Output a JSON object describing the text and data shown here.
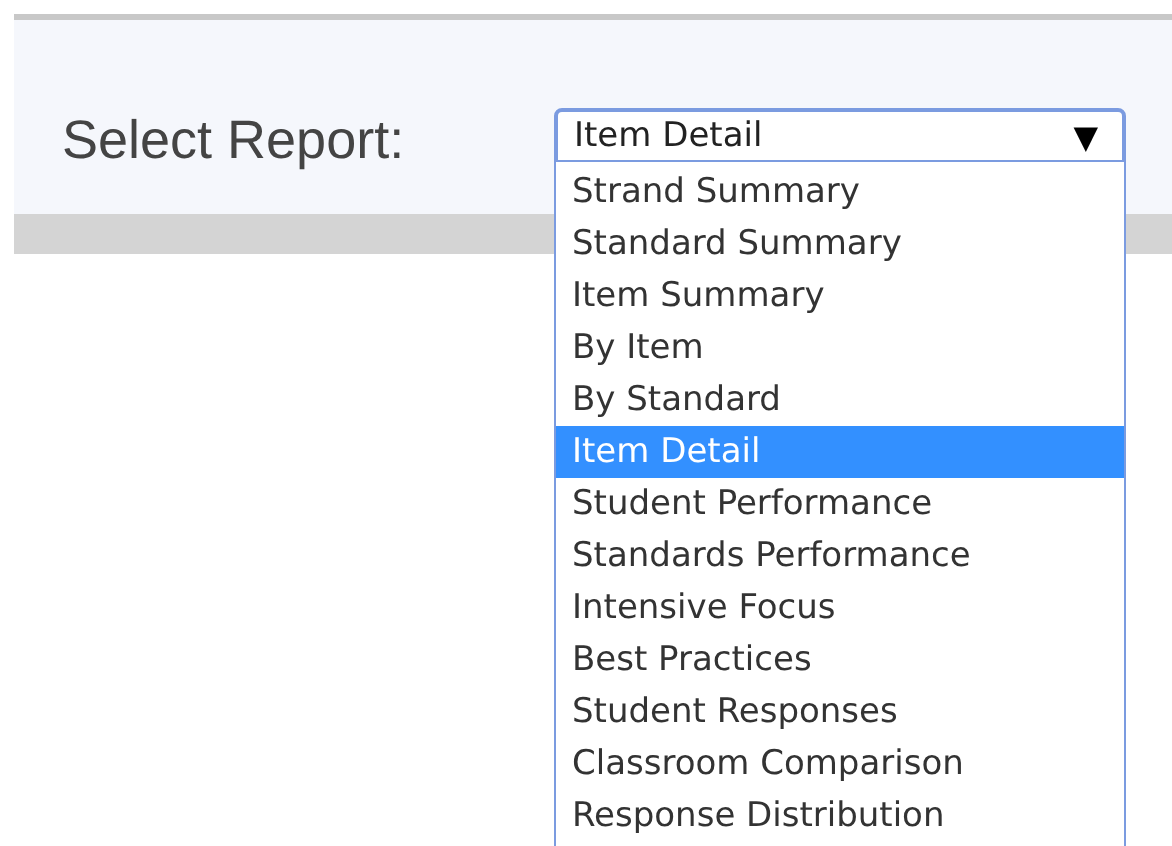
{
  "report_selector": {
    "label": "Select Report:",
    "value": "Item Detail",
    "arrow": "▼",
    "expanded": true,
    "options": [
      {
        "label": "Strand Summary",
        "selected": false
      },
      {
        "label": "Standard Summary",
        "selected": false
      },
      {
        "label": "Item Summary",
        "selected": false
      },
      {
        "label": "By Item",
        "selected": false
      },
      {
        "label": "By Standard",
        "selected": false
      },
      {
        "label": "Item Detail",
        "selected": true
      },
      {
        "label": "Student Performance",
        "selected": false
      },
      {
        "label": "Standards Performance",
        "selected": false
      },
      {
        "label": "Intensive Focus",
        "selected": false
      },
      {
        "label": "Best Practices",
        "selected": false
      },
      {
        "label": "Student Responses",
        "selected": false
      },
      {
        "label": "Classroom Comparison",
        "selected": false
      },
      {
        "label": "Response Distribution",
        "selected": false
      }
    ]
  }
}
